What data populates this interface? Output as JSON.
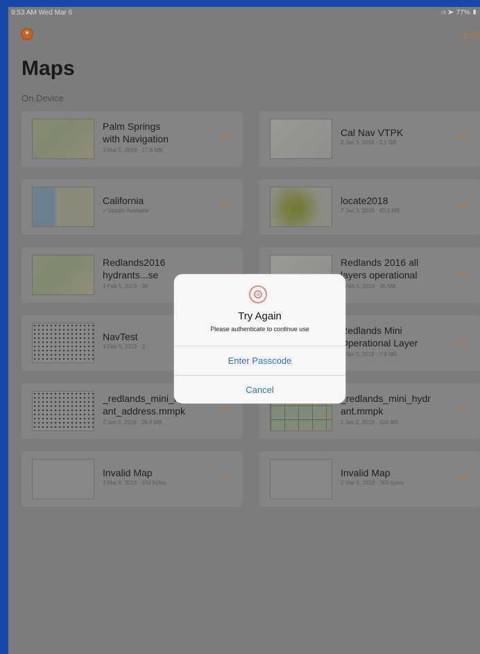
{
  "status": {
    "time": "9:53 AM   Wed Mar 6",
    "indicators": "ત ➤ 77% ▮"
  },
  "header": {
    "edit_label": "Edit",
    "title": "Maps",
    "section": "On Device"
  },
  "maps": [
    {
      "name_line1": "Palm Springs",
      "name_line2": "with Navigation",
      "meta": "3 Mar 5, 2019 · 17.6 MB",
      "thumb": "t-map"
    },
    {
      "name_line1": "Cal Nav VTPK",
      "name_line2": "",
      "meta": "2 Jan 3, 2019 · 2.1 GB",
      "thumb": "t-light"
    },
    {
      "name_line1": "California",
      "name_line2": "",
      "meta": "+ Update Available",
      "thumb": "t-ca"
    },
    {
      "name_line1": "locate2018",
      "name_line2": "",
      "meta": "7 Jan 3, 2019 · 40.1 MB",
      "thumb": "t-green"
    },
    {
      "name_line1": "Redlands2016",
      "name_line2": "hydrants...se",
      "meta": "3 Feb 5, 2019 · 36",
      "thumb": "t-map"
    },
    {
      "name_line1": "Redlands 2016 all",
      "name_line2": "layers operational",
      "meta": "2 Feb 5, 2019 · 35 MB",
      "thumb": "t-light"
    },
    {
      "name_line1": "NavTest",
      "name_line2": "",
      "meta": "3 Feb 5, 2019 · 3",
      "thumb": "t-dots"
    },
    {
      "name_line1": "Redlands Mini",
      "name_line2": "Operational Layer",
      "meta": "2 Jan 3, 2019 · 7.9 MB",
      "thumb": "t-light"
    },
    {
      "name_line1": "_redlands_mini_hydr",
      "name_line2": "ant_address.mmpk",
      "meta": "2 Jan 3, 2019 · 28.4 MB",
      "thumb": "t-dots"
    },
    {
      "name_line1": "_redlands_mini_hydr",
      "name_line2": "ant.mmpk",
      "meta": "2 Jan 2, 2019 · 104 MB",
      "thumb": "t-grid"
    },
    {
      "name_line1": "Invalid Map",
      "name_line2": "",
      "meta": "3 Mar 6, 2019 · 334 bytes",
      "thumb": "t-world"
    },
    {
      "name_line1": "Invalid Map",
      "name_line2": "",
      "meta": "2 Mar 5, 2019 · 365 bytes",
      "thumb": "t-world"
    }
  ],
  "more_label": "•••",
  "dialog": {
    "title": "Try Again",
    "message": "Please authenticate to continue use",
    "passcode_label": "Enter Passcode",
    "cancel_label": "Cancel"
  }
}
